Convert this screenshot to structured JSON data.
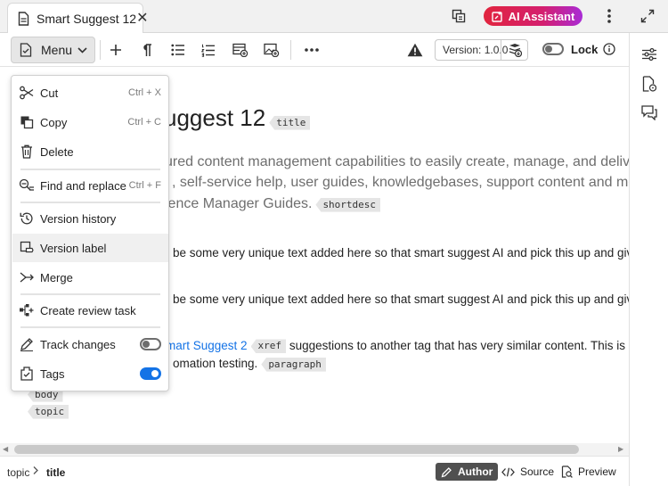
{
  "tab": {
    "title": "Smart Suggest 12",
    "close_glyph": "✕"
  },
  "ai_assistant": {
    "label": "AI Assistant"
  },
  "toolbar": {
    "menu_label": "Menu",
    "version_label": "Version: 1.0.0",
    "lock_label": "Lock",
    "lock_on": false
  },
  "editor": {
    "title_text": "uggest 12",
    "title_tag": "title",
    "shortdesc_lines": [
      "ured content management capabilities to easily create, manage, and delive",
      ", self-service help, user guides, knowledgebases, support content and mor",
      "ience Manager Guides."
    ],
    "shortdesc_tag": "shortdesc",
    "para1": "be some very unique text added here so that smart suggest AI and pick this up and give",
    "para2": "be some very unique text added here so that smart suggest AI and pick this up and give",
    "para3_link": "mart Suggest 2",
    "para3_xref_tag": "xref",
    "para3_rest": "suggestions to another tag that has very similar content. This is being",
    "para3_line2": "omation testing.",
    "paragraph_tag": "paragraph",
    "body_tag": "body",
    "topic_tag": "topic"
  },
  "menu": {
    "items": [
      {
        "label": "Cut",
        "shortcut": "Ctrl + X",
        "icon": "scissors-icon"
      },
      {
        "label": "Copy",
        "shortcut": "Ctrl + C",
        "icon": "copy-icon"
      },
      {
        "label": "Delete",
        "shortcut": "",
        "icon": "trash-icon"
      },
      {
        "label": "Find and replace",
        "shortcut": "Ctrl + F",
        "icon": "find-replace-icon"
      },
      {
        "label": "Version history",
        "shortcut": "",
        "icon": "history-icon"
      },
      {
        "label": "Version label",
        "shortcut": "",
        "icon": "version-label-icon"
      },
      {
        "label": "Merge",
        "shortcut": "",
        "icon": "merge-icon"
      },
      {
        "label": "Create review task",
        "shortcut": "",
        "icon": "review-task-icon"
      },
      {
        "label": "Track changes",
        "toggle": false,
        "icon": "track-changes-icon"
      },
      {
        "label": "Tags",
        "toggle": true,
        "icon": "tags-icon"
      }
    ],
    "highlighted": "Version label"
  },
  "statusbar": {
    "breadcrumb": [
      "topic",
      "title"
    ],
    "modes": [
      {
        "label": "Author",
        "active": true,
        "icon": "author-icon"
      },
      {
        "label": "Source",
        "active": false,
        "icon": "source-icon"
      },
      {
        "label": "Preview",
        "active": false,
        "icon": "preview-icon"
      }
    ]
  },
  "colors": {
    "accent": "#1473e6",
    "ai_gradient_start": "#e1253e",
    "ai_gradient_end": "#a92bd6"
  }
}
